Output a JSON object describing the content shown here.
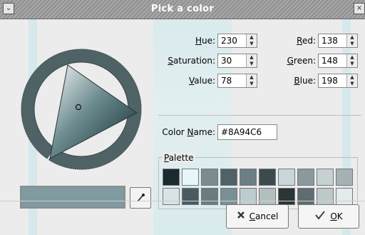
{
  "window": {
    "title": "Pick a color",
    "menu_glyph": "⌄",
    "close_glyph": "×"
  },
  "hsv": {
    "hue": {
      "label_pre": "",
      "label_ul": "H",
      "label_post": "ue:",
      "value": "230"
    },
    "saturation": {
      "label_pre": "",
      "label_ul": "S",
      "label_post": "aturation:",
      "value": "30"
    },
    "value": {
      "label_pre": "",
      "label_ul": "V",
      "label_post": "alue:",
      "value": "78"
    }
  },
  "rgb": {
    "red": {
      "label_pre": "",
      "label_ul": "R",
      "label_post": "ed:",
      "value": "138"
    },
    "green": {
      "label_pre": "",
      "label_ul": "G",
      "label_post": "reen:",
      "value": "148"
    },
    "blue": {
      "label_pre": "",
      "label_ul": "B",
      "label_post": "lue:",
      "value": "198"
    }
  },
  "color_name": {
    "label_pre": "Color ",
    "label_ul": "N",
    "label_post": "ame:",
    "value": "#8A94C6"
  },
  "palette": {
    "label_ul": "P",
    "label_post": "alette",
    "row1": [
      "#1a2a2e",
      "#e6f7fb",
      "#7a8c90",
      "#4f6267",
      "#6b7f84",
      "#3d4a4d",
      "#c9d6d9",
      "#8c999c",
      "#c6d1d3",
      "#a6b1b3"
    ],
    "row2": [
      "#d8e3e6",
      "#4a5b60",
      "#6b7c80",
      "#7a9096",
      "#bccbce",
      "#b2bfc1",
      "#2b3436",
      "#5f6d70",
      "#bcc8ca",
      "#e3eaec"
    ]
  },
  "current_color": "#7f9aa1",
  "buttons": {
    "cancel": {
      "label_ul": "C",
      "label_post": "ancel"
    },
    "ok": {
      "label_ul": "O",
      "label_post": "K"
    }
  },
  "icons": {
    "cancel": "cancel-x-icon",
    "ok": "checkmark-icon",
    "dropper": "eyedropper-icon"
  }
}
